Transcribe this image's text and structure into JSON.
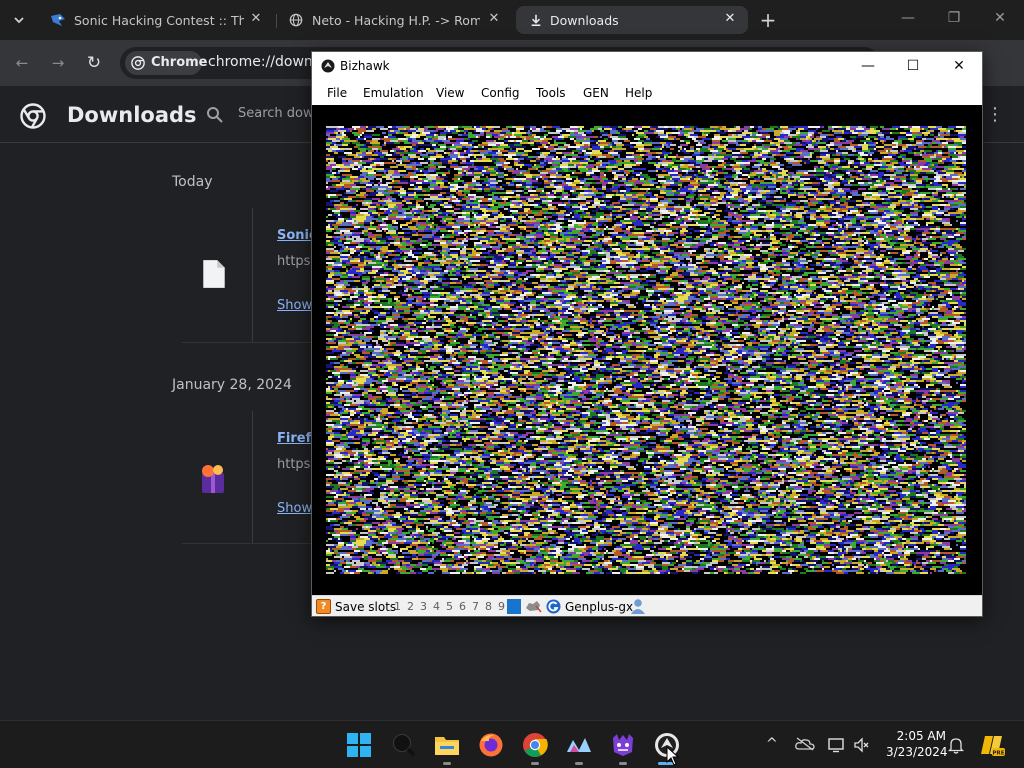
{
  "chrome": {
    "tab_search_icon": "chevron-down-icon",
    "tabs": [
      {
        "title": "Sonic Hacking Contest :: The Sh",
        "favicon": "sonic-icon"
      },
      {
        "title": "Neto - Hacking H.P. -> Roms h",
        "favicon": "globe-icon"
      },
      {
        "title": "Downloads",
        "favicon": "download-icon",
        "active": true
      }
    ],
    "new_tab": "+",
    "window_controls": {
      "minimize": "—",
      "restore": "❐",
      "close": "✕"
    },
    "toolbar": {
      "back": "←",
      "forward": "→",
      "reload": "↻",
      "chip_label": "Chrome",
      "url": "chrome://downloads"
    }
  },
  "downloads": {
    "title": "Downloads",
    "search_placeholder": "Search downloads",
    "more": "⋮",
    "groups": [
      {
        "date": "Today",
        "items": [
          {
            "name": "Sonic",
            "source": "https:",
            "action": "Show",
            "icon": "file-icon"
          }
        ]
      },
      {
        "date": "January 28, 2024",
        "items": [
          {
            "name": "Firefo",
            "source": "https:",
            "action": "Show",
            "icon": "firefox-installer-icon"
          }
        ]
      }
    ]
  },
  "bizhawk": {
    "title": "Bizhawk",
    "menu": [
      "File",
      "Emulation",
      "View",
      "Config",
      "Tools",
      "GEN",
      "Help"
    ],
    "status": {
      "save_slots_label": "Save slots",
      "slots": [
        "1",
        "2",
        "3",
        "4",
        "5",
        "6",
        "7",
        "8",
        "9"
      ],
      "core": "Genplus-gx"
    },
    "controls": {
      "minimize": "—",
      "maximize": "☐",
      "close": "✕"
    }
  },
  "taskbar": {
    "apps": [
      "windows-start-icon",
      "search-icon",
      "file-explorer-icon",
      "firefox-icon",
      "chrome-icon",
      "app-wave-icon",
      "app-monster-icon",
      "bizhawk-icon"
    ],
    "tray": {
      "chevron": "^",
      "clock_time": "2:05 AM",
      "clock_date": "3/23/2024"
    }
  },
  "colors": {
    "chrome_bg": "#202124",
    "link": "#8ab4f8",
    "bizhawk_slot_selected": "#1874cd"
  }
}
